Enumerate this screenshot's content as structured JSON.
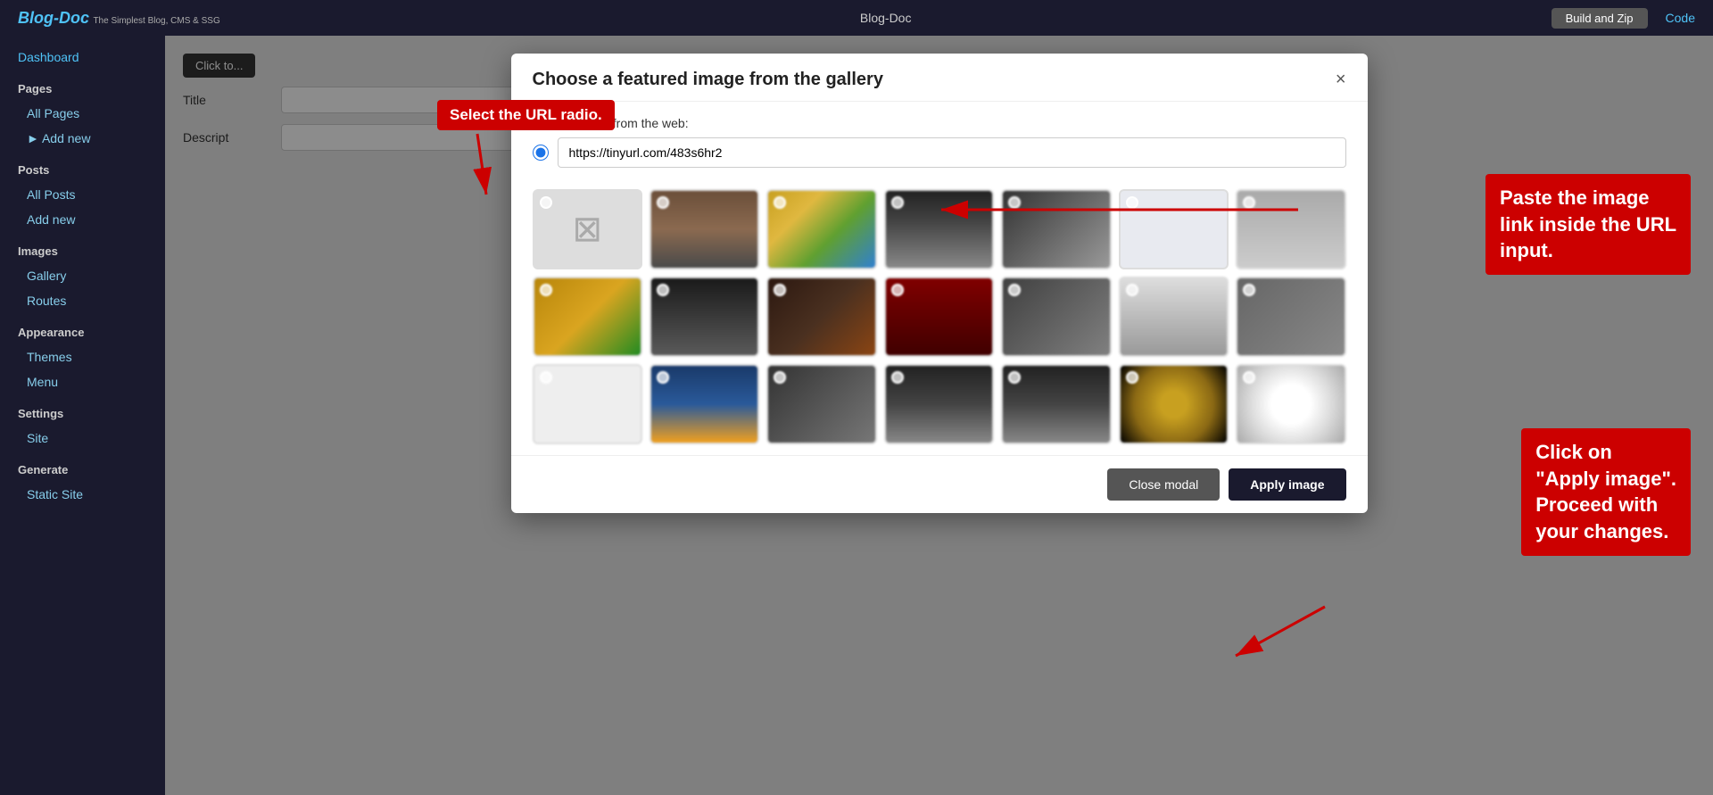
{
  "navbar": {
    "brand": "Blog-Doc",
    "brand_sub": "The Simplest Blog, CMS & SSG",
    "center": "Blog-Doc",
    "build_btn": "Build and Zip",
    "code_link": "Code"
  },
  "sidebar": {
    "dashboard": "Dashboard",
    "pages_header": "Pages",
    "all_pages": "All Pages",
    "add_new_pages": "► Add new",
    "posts_header": "Posts",
    "all_posts": "All Posts",
    "add_new_posts": "Add new",
    "images_header": "Images",
    "gallery": "Gallery",
    "routes": "Routes",
    "appearance_header": "Appearance",
    "themes": "Themes",
    "menu": "Menu",
    "settings_header": "Settings",
    "site": "Site",
    "generate_header": "Generate",
    "static_site": "Static Site"
  },
  "content_toolbar": {
    "click_to": "Click to..."
  },
  "modal": {
    "title": "Choose a featured image from the gallery",
    "close_x": "×",
    "url_label": "Use an image from the web:",
    "url_value": "https://tinyurl.com/483s6hr2",
    "url_placeholder": "https://tinyurl.com/483s6hr2",
    "close_modal_btn": "Close modal",
    "apply_image_btn": "Apply image"
  },
  "annotations": {
    "url_radio_tooltip": "Select the URL radio.",
    "paste_tooltip": "Paste the\nimage link\ninside the\nURL input.",
    "apply_tooltip": "Click on\n\"Apply image\".\nProceed with\nyour changes."
  },
  "bg_form": {
    "title_label": "Title",
    "description_label": "Descript"
  }
}
